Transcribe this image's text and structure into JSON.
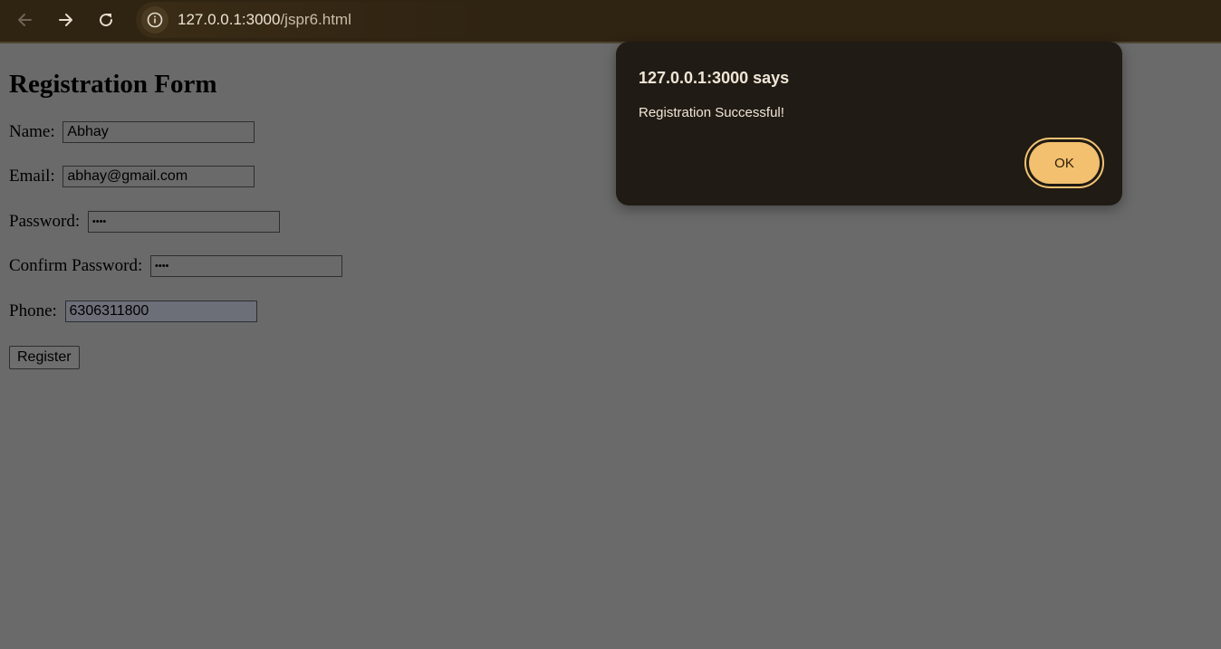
{
  "browser": {
    "url_host": "127.0.0.1:3000",
    "url_path": "/jspr6.html"
  },
  "form": {
    "title": "Registration Form",
    "fields": [
      {
        "label": "Name:",
        "value": "Abhay"
      },
      {
        "label": "Email:",
        "value": "abhay@gmail.com"
      },
      {
        "label": "Password:",
        "value": "••••"
      },
      {
        "label": "Confirm Password:",
        "value": "••••"
      },
      {
        "label": "Phone:",
        "value": "6306311800"
      }
    ],
    "submit_label": "Register"
  },
  "dialog": {
    "title": "127.0.0.1:3000 says",
    "message": "Registration Successful!",
    "ok_label": "OK"
  },
  "colors": {
    "dialog_bg": "#201b14",
    "ok_button": "#f2c06e",
    "backdrop": "#6a6a6a"
  }
}
